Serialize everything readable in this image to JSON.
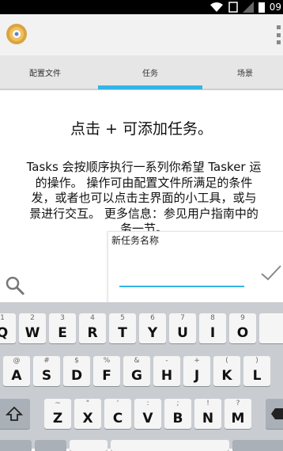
{
  "status_bar": {
    "time": "09"
  },
  "tabs": [
    {
      "label": "配置文件"
    },
    {
      "label": "任务"
    },
    {
      "label": "场景"
    }
  ],
  "main": {
    "hint_title": "点击 + 可添加任务。",
    "description_lines": [
      "Tasks 会按顺序执行一系列你希望 Tasker 运",
      "的操作。 操作可由配置文件所满足的条件",
      "发，或者也可以点击主界面的小工具，或与",
      "景进行交互。 更多信息：参见用户指南中的",
      "务一节。"
    ]
  },
  "dialog": {
    "label": "新任务名称",
    "input_value": ""
  },
  "keyboard": {
    "row1": [
      {
        "main": "Q",
        "sub": "1"
      },
      {
        "main": "W",
        "sub": "2"
      },
      {
        "main": "E",
        "sub": "3"
      },
      {
        "main": "R",
        "sub": "4"
      },
      {
        "main": "T",
        "sub": "5"
      },
      {
        "main": "Y",
        "sub": "6"
      },
      {
        "main": "U",
        "sub": "7"
      },
      {
        "main": "I",
        "sub": "8"
      },
      {
        "main": "O",
        "sub": "9"
      }
    ],
    "row2": [
      {
        "main": "A",
        "sub": "@"
      },
      {
        "main": "S",
        "sub": "#"
      },
      {
        "main": "D",
        "sub": "$"
      },
      {
        "main": "F",
        "sub": "%"
      },
      {
        "main": "G",
        "sub": "&"
      },
      {
        "main": "H",
        "sub": "-"
      },
      {
        "main": "J",
        "sub": "+"
      },
      {
        "main": "K",
        "sub": "("
      },
      {
        "main": "L",
        "sub": ")"
      }
    ],
    "row3": [
      {
        "main": "Z",
        "sub": "~"
      },
      {
        "main": "X",
        "sub": "\""
      },
      {
        "main": "C",
        "sub": "'"
      },
      {
        "main": "V",
        "sub": ":"
      },
      {
        "main": "B",
        "sub": ";"
      },
      {
        "main": "N",
        "sub": "!"
      },
      {
        "main": "M",
        "sub": "?"
      }
    ],
    "colors": {
      "keyboard_bg": "#c9cdd2",
      "key_bg": "#f5f5f5",
      "accent": "#33b5e5"
    }
  }
}
